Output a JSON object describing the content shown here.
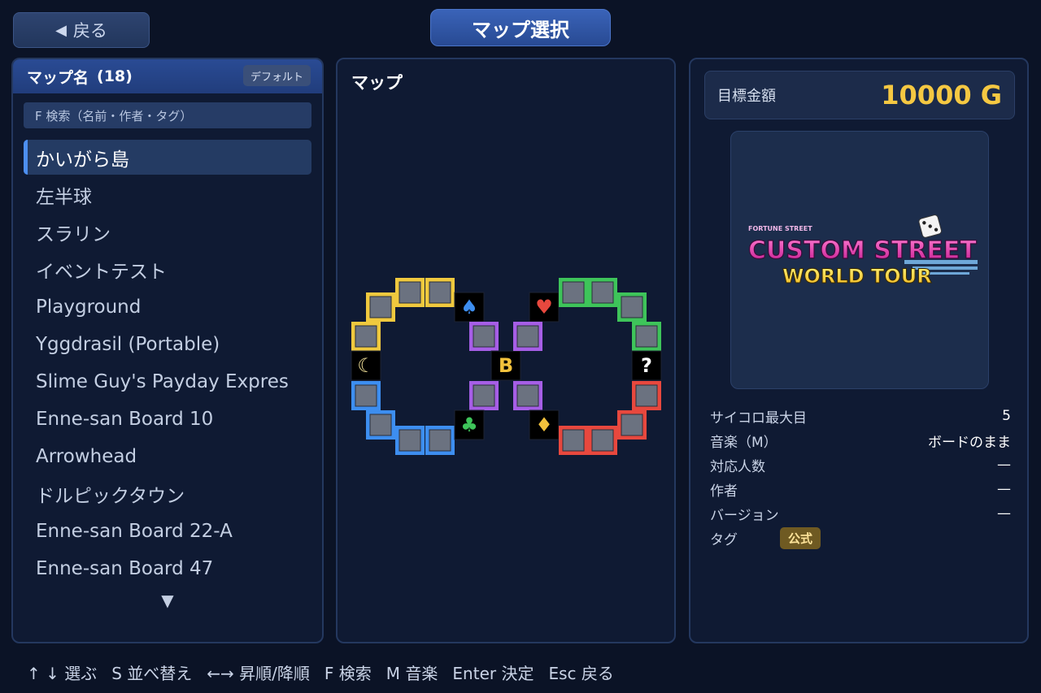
{
  "header": {
    "back_label": "戻る",
    "title": "マップ選択"
  },
  "list": {
    "header_label": "マップ名",
    "count": "(18)",
    "sort_label": "デフォルト",
    "search_placeholder": "F 検索（名前・作者・タグ）",
    "items": [
      "かいがら島",
      "左半球",
      "スラリン",
      "イベントテスト",
      "Playground",
      "Yggdrasil (Portable)",
      "Slime Guy's Payday Expres",
      "Enne-san Board 10",
      "Arrowhead",
      "ドルピックタウン",
      "Enne-san Board 22-A",
      "Enne-san Board 47"
    ],
    "selected_index": 0,
    "more_indicator": "▼"
  },
  "preview": {
    "title": "マップ",
    "bank_letter": "B",
    "question_mark": "?",
    "colors": {
      "yellow": "#f0c93e",
      "blue": "#3d8ef0",
      "purple": "#a65ee6",
      "green": "#3ec45a",
      "red": "#e8483e",
      "tile": "#6b7280"
    }
  },
  "details": {
    "goal_label": "目標金額",
    "goal_value": "10000 G",
    "logo": {
      "brand": "FORTUNE STREET",
      "line1": "CUSTOM STREET",
      "line2": "WORLD TOUR"
    },
    "rows": [
      {
        "key": "サイコロ最大目",
        "value": "5"
      },
      {
        "key": "音楽（M）",
        "value": "ボードのまま"
      },
      {
        "key": "対応人数",
        "value": "—"
      },
      {
        "key": "作者",
        "value": "—"
      },
      {
        "key": "バージョン",
        "value": "—"
      }
    ],
    "tag_label": "タグ",
    "tag_value": "公式"
  },
  "footer": {
    "hints": [
      "↑ ↓ 選ぶ",
      "S 並べ替え",
      "←→ 昇順/降順",
      "F 検索",
      "M 音楽",
      "Enter 決定",
      "Esc 戻る"
    ]
  }
}
